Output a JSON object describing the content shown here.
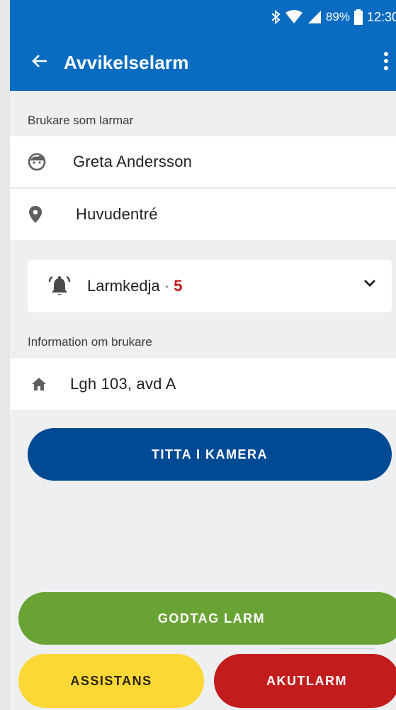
{
  "status_bar": {
    "battery": "89%",
    "time": "12:30",
    "icons": [
      "bluetooth-icon",
      "wifi-icon",
      "signal-icon",
      "battery-icon"
    ]
  },
  "app_bar": {
    "title": "Avvikelselarm",
    "back_icon": "arrow-back-icon",
    "menu_icon": "more-vert-icon"
  },
  "alarming_user": {
    "section_label": "Brukare som larmar",
    "name": "Greta Andersson",
    "name_icon": "face-icon",
    "location": "Huvudentré",
    "location_icon": "location-pin-icon"
  },
  "alarm_chain": {
    "label": "Larmkedja",
    "separator": " · ",
    "count": "5",
    "icon": "bell-ring-icon",
    "expand_icon": "chevron-down-icon"
  },
  "user_info": {
    "section_label": "Information om brukare",
    "apartment": "Lgh 103, avd A",
    "apartment_icon": "home-icon"
  },
  "actions": {
    "camera": "TITTA I KAMERA",
    "accept": "GODTAG LARM",
    "assist": "ASSISTANS",
    "emergency": "AKUTLARM"
  },
  "colors": {
    "primary": "#0a6cc1",
    "camera_button": "#004a94",
    "accept_button": "#6aa335",
    "assist_button": "#fcd837",
    "emergency_button": "#c31c1c",
    "count_accent": "#c01818"
  }
}
